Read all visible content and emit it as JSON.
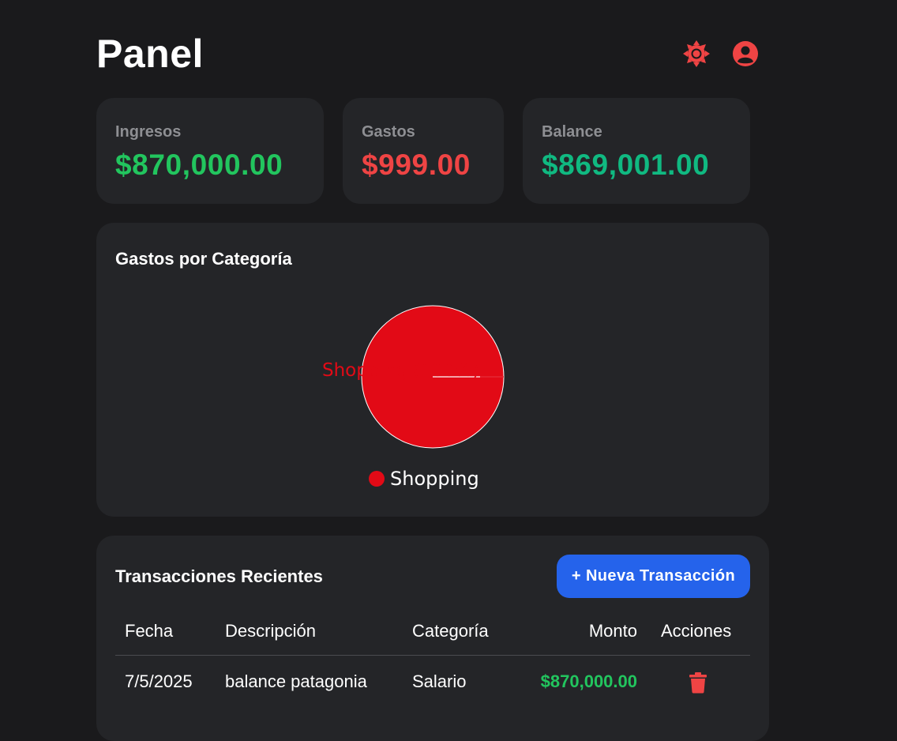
{
  "header": {
    "title": "Panel",
    "theme_icon": "sun-icon",
    "profile_icon": "user-circle-icon"
  },
  "stats": [
    {
      "label": "Ingresos",
      "value": "$870,000.00",
      "color": "#22c55e"
    },
    {
      "label": "Gastos",
      "value": "$999.00",
      "color": "#ef4444"
    },
    {
      "label": "Balance",
      "value": "$869,001.00",
      "color": "#10b981"
    }
  ],
  "chart_section": {
    "title": "Gastos por Categoría"
  },
  "chart_data": {
    "type": "pie",
    "slices": [
      {
        "name": "Shopping",
        "value": 100,
        "label": "Shopping (100%)",
        "color": "#e20a16"
      }
    ],
    "legend": [
      "Shopping"
    ],
    "legend_placement": "bottom"
  },
  "transactions": {
    "title": "Transacciones Recientes",
    "new_button_label": "+ Nueva Transacción",
    "columns": [
      "Fecha",
      "Descripción",
      "Categoría",
      "Monto",
      "Acciones"
    ],
    "rows": [
      {
        "date": "7/5/2025",
        "description": "balance patagonia",
        "category": "Salario",
        "amount": "$870,000.00",
        "action_icon": "trash-icon"
      }
    ]
  },
  "colors": {
    "accent_red": "#ef4444",
    "income_green": "#22c55e",
    "balance_green": "#10b981",
    "primary_blue": "#2563eb",
    "card_bg": "#242528",
    "page_bg": "#1a1a1c"
  }
}
